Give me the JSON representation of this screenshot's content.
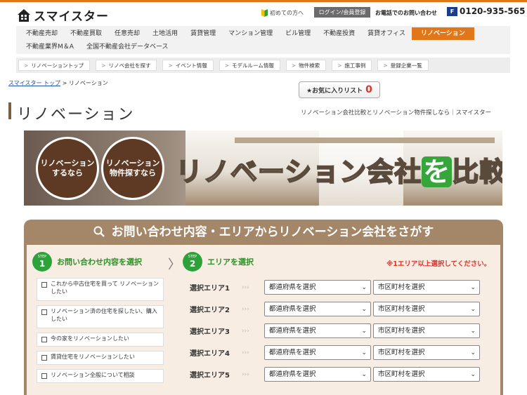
{
  "header": {
    "logo_text": "スマイスター",
    "first_time": "初めての方へ",
    "login": "ログイン/会員登録",
    "phone_label": "お電話でのお問い合わせ",
    "freedial_icon": "freedial-icon",
    "phone": "0120-935-565"
  },
  "nav": {
    "row1": [
      "不動産売却",
      "不動産買取",
      "任意売却",
      "土地活用",
      "賃貸管理",
      "マンション管理",
      "ビル管理",
      "不動産投資",
      "賃貸オフィス",
      "リノベーション"
    ],
    "row2": [
      "不動産業界M＆A",
      "全国不動産会社データベース"
    ],
    "active_index": 9
  },
  "subnav": [
    "リノベーショントップ",
    "リノベ会社を探す",
    "イベント情報",
    "モデルルーム情報",
    "物件検索",
    "施工事例",
    "登録企業一覧"
  ],
  "breadcrumb": {
    "home": "スマイスター トップ",
    "sep": " > ",
    "current": "リノベーション"
  },
  "favorite": {
    "label": "★お気に入りリスト",
    "count": "0"
  },
  "page": {
    "title": "リノベーション",
    "tagline": "リノベーション会社比較とリノベーション物件探しなら｜スマイスター"
  },
  "banner": {
    "circle1": "リノベーション するなら",
    "circle2": "リノベーション 物件探すなら",
    "headline_a": "リノベーション会社",
    "headline_wo": "を",
    "headline_b": "比較"
  },
  "search": {
    "heading": "お問い合わせ内容・エリアからリノベーション会社をさがす",
    "step_word": "STEP",
    "step1_num": "1",
    "step1_label": "お問い合わせ内容を選択",
    "step2_num": "2",
    "step2_label": "エリアを選択",
    "note": "※1エリア以上選択してください。",
    "checks": [
      "これから中古住宅を買って リノベーションしたい",
      "リノベーション済の住宅を探したい、購入したい",
      "今の家をリノベーションしたい",
      "賃貸住宅をリノベーションしたい",
      "リノベーション全般について相談"
    ],
    "areas": [
      {
        "label": "選択エリア1",
        "pref": "都道府県を選択",
        "city": "市区町村を選択"
      },
      {
        "label": "選択エリア2",
        "pref": "都道府県を選択",
        "city": "市区町村を選択"
      },
      {
        "label": "選択エリア3",
        "pref": "都道府県を選択",
        "city": "市区町村を選択"
      },
      {
        "label": "選択エリア4",
        "pref": "都道府県を選択",
        "city": "市区町村を選択"
      },
      {
        "label": "選択エリア5",
        "pref": "都道府県を選択",
        "city": "市区町村を選択"
      }
    ],
    "arrows": "›››"
  },
  "colors": {
    "accent": "#e2771a",
    "step_green": "#2ea23a",
    "panel_brown": "#a48769",
    "note_red": "#e0312b"
  }
}
